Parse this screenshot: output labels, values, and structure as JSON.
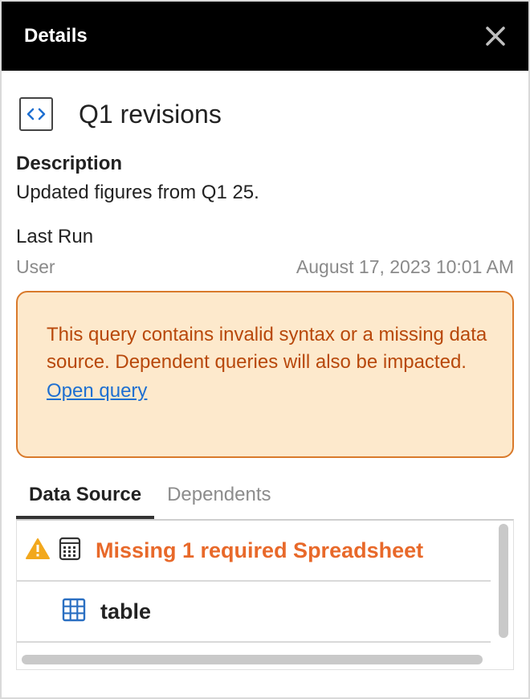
{
  "header": {
    "title": "Details"
  },
  "query": {
    "name": "Q1 revisions"
  },
  "description": {
    "label": "Description",
    "text": "Updated figures from Q1 25."
  },
  "last_run": {
    "label": "Last Run",
    "user": "User",
    "timestamp": "August 17, 2023 10:01 AM"
  },
  "warning": {
    "message": "This query contains invalid syntax or a missing data source. Dependent queries will also be impacted.",
    "link": "Open query"
  },
  "tabs": [
    {
      "label": "Data Source",
      "active": true
    },
    {
      "label": "Dependents",
      "active": false
    }
  ],
  "data_source_items": [
    {
      "label": "Missing 1 required Spreadsheet",
      "icon": "spreadsheet-icon",
      "status": "warning"
    },
    {
      "label": "table",
      "icon": "table-grid-icon",
      "status": "ok"
    }
  ],
  "colors": {
    "header_bg": "#000000",
    "warning_bg": "#fde9cc",
    "warning_border": "#d97a2b",
    "warning_text": "#b8480b",
    "link": "#1e6fd1",
    "missing_text": "#e8692a",
    "warning_icon": "#f2a81d",
    "table_icon": "#2a6fc2"
  }
}
